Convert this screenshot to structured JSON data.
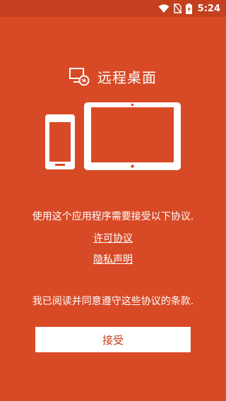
{
  "status_bar": {
    "time": "5:24",
    "icons": [
      "wifi-icon",
      "no-sim-icon",
      "battery-charging-icon"
    ]
  },
  "app": {
    "title": "远程桌面",
    "logo_icon": "remote-desktop-icon"
  },
  "illustration": {
    "devices": [
      "phone-illustration",
      "tablet-illustration"
    ]
  },
  "license": {
    "message": "使用这个应用程序需要接受以下协议.",
    "license_link": "许可协议",
    "privacy_link": "隐私声明",
    "agree_text": "我已阅读并同意遵守这些协议的条款."
  },
  "actions": {
    "accept_label": "接受"
  },
  "colors": {
    "background": "#d84a26",
    "status_bar": "#c4401f",
    "foreground": "#ffffff"
  }
}
